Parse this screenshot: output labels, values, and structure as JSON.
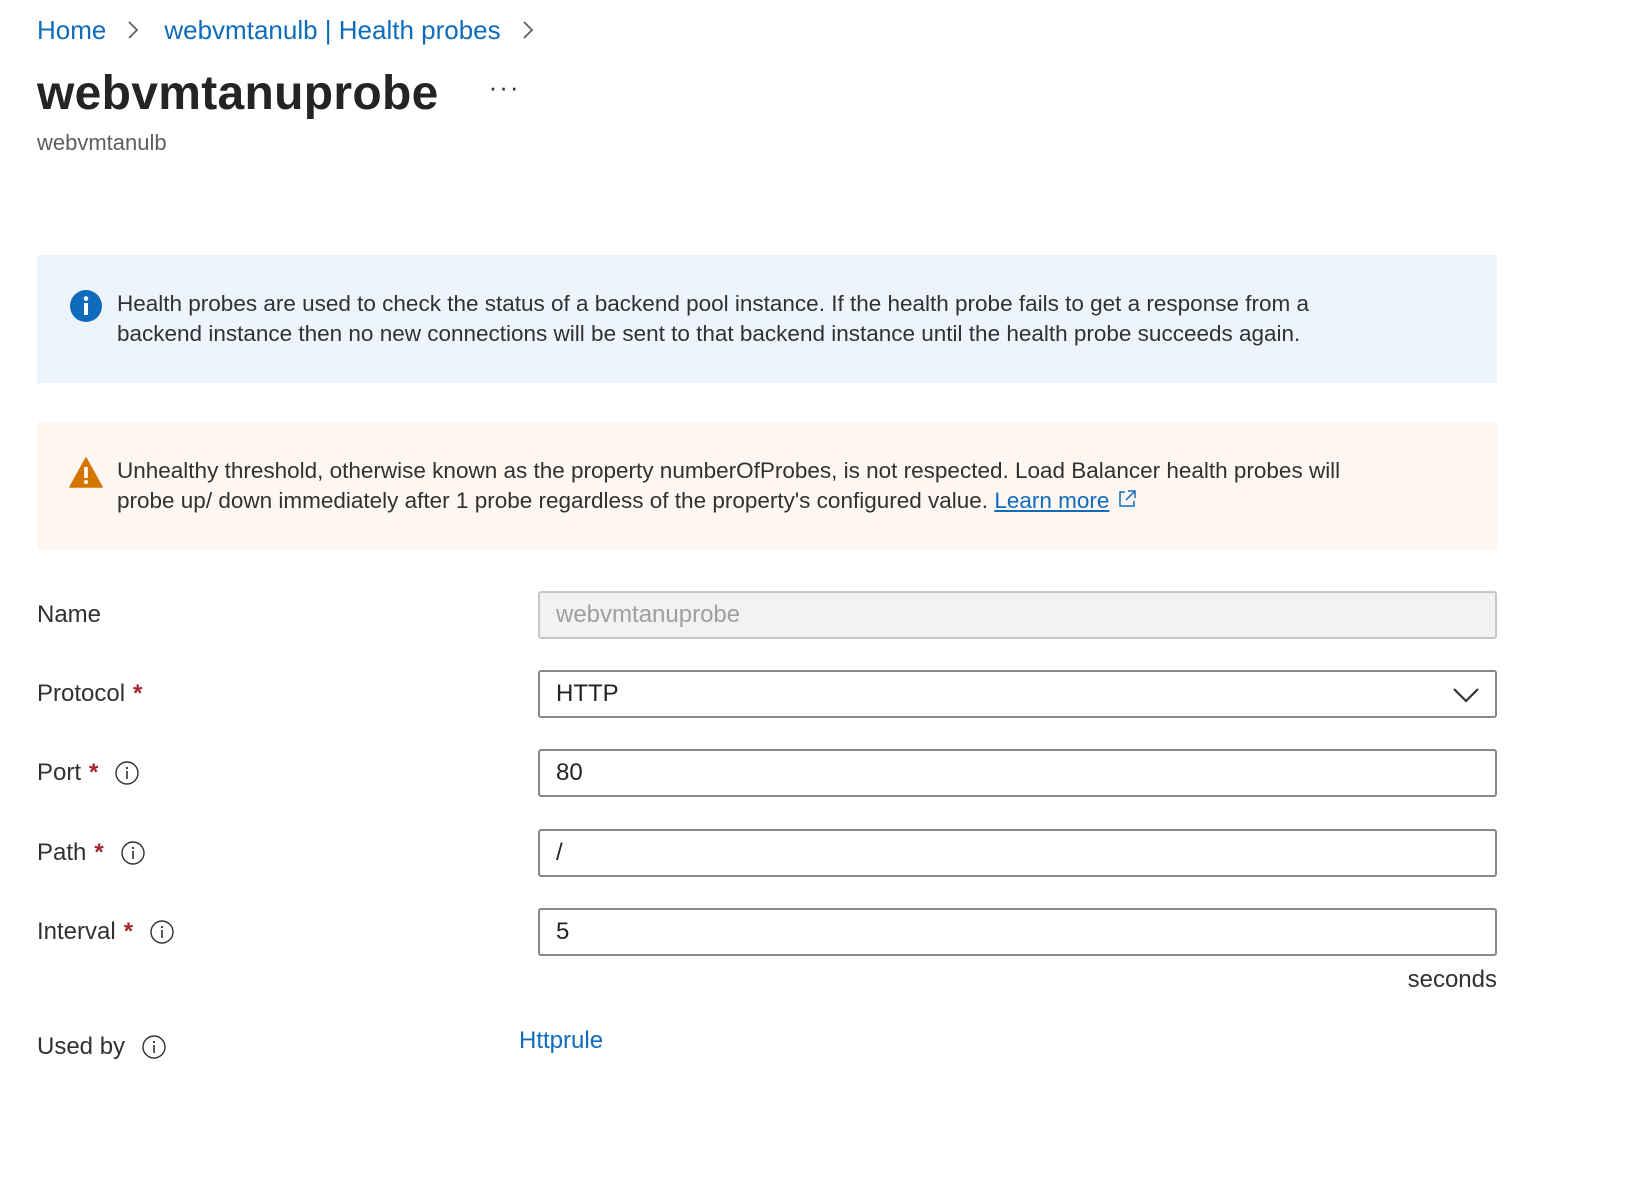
{
  "breadcrumb": {
    "items": [
      "Home",
      "webvmtanulb | Health probes"
    ]
  },
  "header": {
    "title": "webvmtanuprobe",
    "more_label": "···",
    "subtitle": "webvmtanulb"
  },
  "info_banner": {
    "icon": "info-icon",
    "line1": "Health probes are used to check the status of a backend pool instance. If the health probe fails to get a response from a",
    "line2": "backend instance then no new connections will be sent to that backend instance until the health probe succeeds again."
  },
  "warning_banner": {
    "icon": "warning-icon",
    "line1": "Unhealthy threshold, otherwise known as the property numberOfProbes, is not respected. Load Balancer health probes will",
    "line2": "probe up/ down immediately after 1 probe regardless of the property's configured value.",
    "link_label": "Learn more"
  },
  "form": {
    "name": {
      "label": "Name",
      "value": "webvmtanuprobe"
    },
    "protocol": {
      "label": "Protocol",
      "required": "*",
      "value": "HTTP"
    },
    "port": {
      "label": "Port",
      "required": "*",
      "value": "80"
    },
    "path": {
      "label": "Path",
      "required": "*",
      "value": "/"
    },
    "interval": {
      "label": "Interval",
      "required": "*",
      "value": "5",
      "unit": "seconds"
    },
    "used_by": {
      "label": "Used by",
      "link": "Httprule"
    }
  },
  "colors": {
    "link": "#0f6cbd",
    "info_bg": "#eef4fc",
    "warning_bg": "#fdf6f1",
    "warning_icon": "#d47500",
    "info_icon": "#0f6cbd",
    "required": "#a4262c"
  }
}
